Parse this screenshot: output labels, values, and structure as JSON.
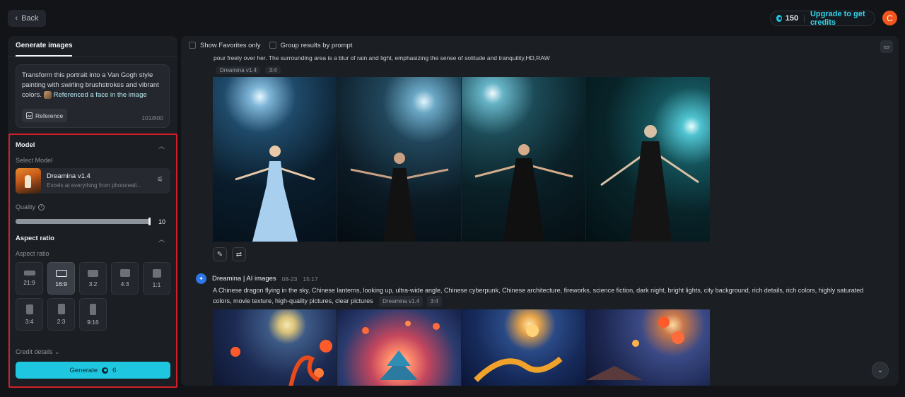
{
  "topbar": {
    "back_label": "Back",
    "credits_count": "150",
    "upgrade_label": "Upgrade to get credits",
    "avatar_letter": "C"
  },
  "left_panel": {
    "tab_label": "Generate images",
    "prompt_text": "Transform this portrait into a Van Gogh style painting with swirling brushstrokes and vibrant colors.",
    "reference_chip": "Referenced a face in the image",
    "reference_button": "Reference",
    "char_count": "101/800",
    "model_section": {
      "title": "Model",
      "select_label": "Select Model",
      "model_name": "Dreamina v1.4",
      "model_desc": "Excels at everything from photoreali..."
    },
    "quality": {
      "label": "Quality",
      "value": "10",
      "fraction": 1.0
    },
    "aspect_section": {
      "title": "Aspect ratio",
      "sub_label": "Aspect ratio",
      "options": [
        "21:9",
        "16:9",
        "3:2",
        "4:3",
        "1:1",
        "3:4",
        "2:3",
        "9:16"
      ],
      "selected": "16:9"
    },
    "credit_details_label": "Credit details",
    "generate_label": "Generate",
    "generate_cost": "6"
  },
  "main": {
    "filter_favorites": "Show Favorites only",
    "filter_group": "Group results by prompt",
    "group1": {
      "prompt_tail": "pour freely over her. The surrounding area is a blur of rain and light, emphasizing the sense of solitude and tranquility,HD,RAW",
      "tag_model": "Dreamina v1.4",
      "tag_ratio": "3:4"
    },
    "group2": {
      "brand": "Dreamina | AI images",
      "date": "08-23",
      "time": "15:17",
      "prompt": "A Chinese dragon flying in the sky, Chinese lanterns, looking up, ultra-wide angle, Chinese cyberpunk, Chinese architecture, fireworks, science fiction, dark night, bright lights, city background, rich details, rich colors, highly saturated colors, movie texture, high-quality pictures, clear pictures",
      "tag_model": "Dreamina v1.4",
      "tag_ratio": "3:4"
    }
  },
  "colors": {
    "accent": "#1fc6df",
    "highlight_border": "#d11f2a",
    "avatar": "#f0561d"
  }
}
